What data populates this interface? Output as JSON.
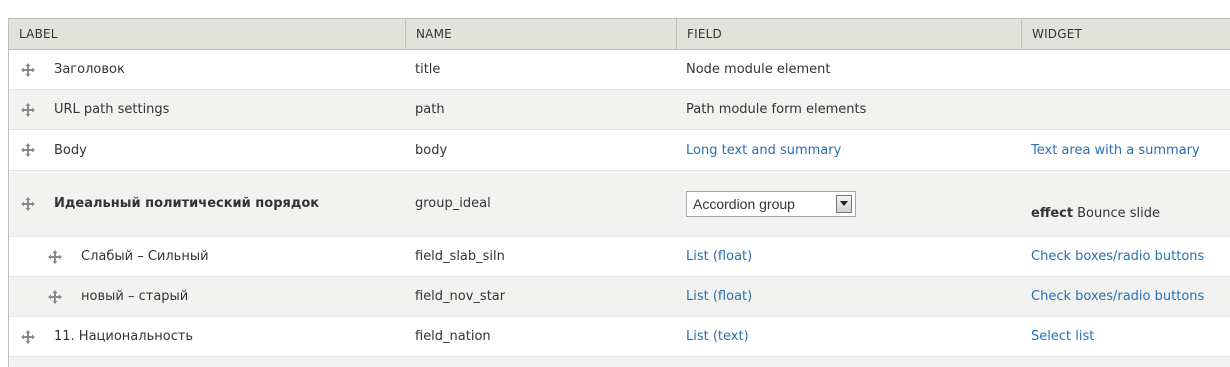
{
  "headers": {
    "label": "LABEL",
    "name": "NAME",
    "field": "FIELD",
    "widget": "WIDGET"
  },
  "rows": [
    {
      "label": "Заголовок",
      "name": "title",
      "field": "Node module element",
      "widget": ""
    },
    {
      "label": "URL path settings",
      "name": "path",
      "field": "Path module form elements",
      "widget": ""
    },
    {
      "label": "Body",
      "name": "body",
      "field": "Long text and summary",
      "widget": "Text area with a summary"
    },
    {
      "label": "Идеальный политический порядок",
      "name": "group_ideal",
      "field_select": "Accordion group",
      "widget_effect_label": "effect",
      "widget_effect_value": "Bounce slide"
    },
    {
      "label": "Слабый – Сильный",
      "name": "field_slab_siln",
      "field": "List (float)",
      "widget": "Check boxes/radio buttons"
    },
    {
      "label": "новый – старый",
      "name": "field_nov_star",
      "field": "List (float)",
      "widget": "Check boxes/radio buttons"
    },
    {
      "label": "11. Национальность",
      "name": "field_nation",
      "field": "List (text)",
      "widget": "Select list"
    }
  ]
}
